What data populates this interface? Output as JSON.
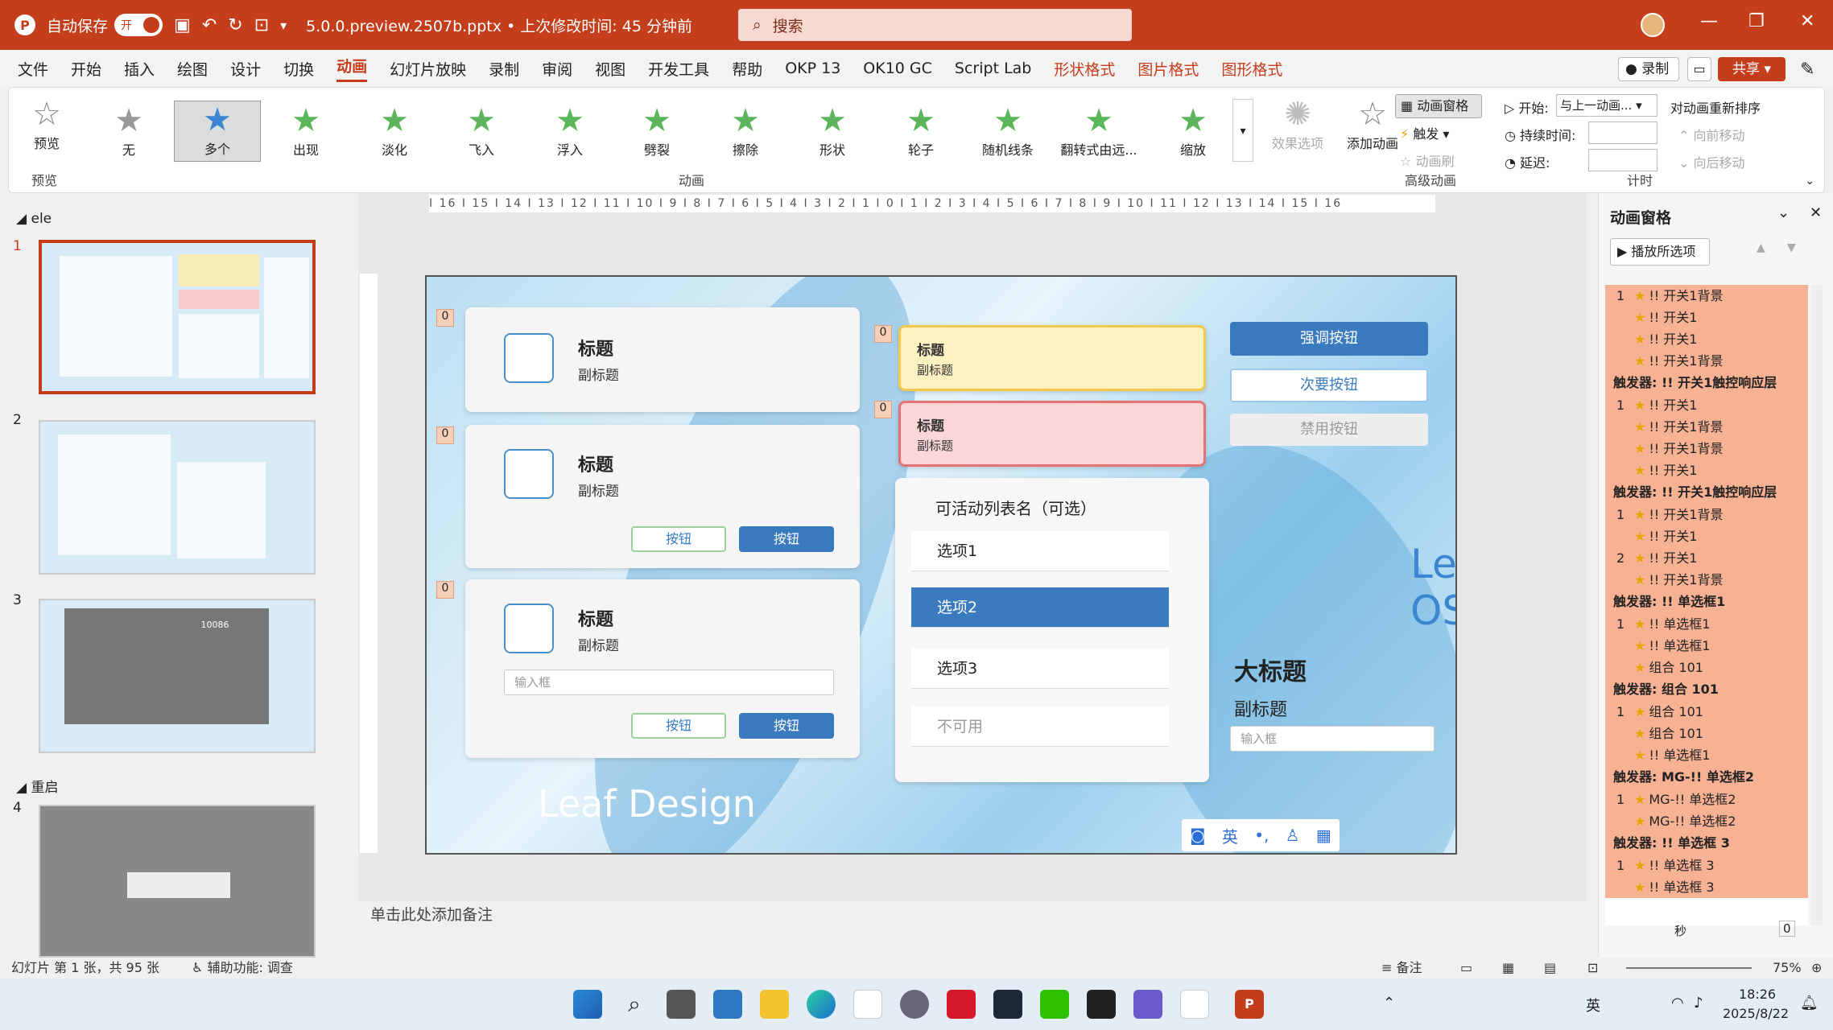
{
  "titlebar": {
    "autosave_label": "自动保存",
    "toggle": "开",
    "filename": "5.0.0.preview.2507b.pptx • 上次修改时间: 45 分钟前",
    "search_placeholder": "搜索"
  },
  "menu": [
    "文件",
    "开始",
    "插入",
    "绘图",
    "设计",
    "切换",
    "动画",
    "幻灯片放映",
    "录制",
    "审阅",
    "视图",
    "开发工具",
    "帮助",
    "OKP 13",
    "OK10 GC",
    "Script Lab",
    "形状格式",
    "图片格式",
    "图形格式"
  ],
  "menu_right": {
    "record": "录制",
    "share": "共享"
  },
  "ribbon": {
    "preview": "预览",
    "effects": [
      "无",
      "多个",
      "出现",
      "淡化",
      "飞入",
      "浮入",
      "劈裂",
      "擦除",
      "形状",
      "轮子",
      "随机线条",
      "翻转式由远...",
      "缩放"
    ],
    "effect_options": "效果选项",
    "add_animation": "添加动画",
    "anim_pane": "动画窗格",
    "trigger": "触发",
    "anim_brush": "动画刷",
    "start_label": "开始:",
    "start_value": "与上一动画...",
    "duration_label": "持续时间:",
    "delay_label": "延迟:",
    "reorder": "对动画重新排序",
    "move_earlier": "向前移动",
    "move_later": "向后移动",
    "group_anim": "动画",
    "group_adv": "高级动画",
    "group_timing": "计时",
    "group_preview": "预览"
  },
  "slides_pane": {
    "section1": "ele",
    "section2": "重启",
    "numbers": [
      "1",
      "2",
      "3",
      "4"
    ],
    "thumb3_text": "10086"
  },
  "slide": {
    "card_title": "标题",
    "card_sub": "副标题",
    "btn": "按钮",
    "input": "输入框",
    "list_title": "可活动列表名（可选）",
    "options": [
      "选项1",
      "选项2",
      "选项3",
      "不可用"
    ],
    "strong_btn": "强调按钮",
    "secondary_btn": "次要按钮",
    "disabled_btn": "禁用按钮",
    "big_title": "大标题",
    "big_sub": "副标题",
    "leaf_os": "Leaf OS",
    "leaf_design": "Leaf Design",
    "ime": "英",
    "tag0": "0"
  },
  "notes": "单击此处添加备注",
  "anim_pane": {
    "title": "动画窗格",
    "play": "播放所选项",
    "rows": [
      {
        "t": "row",
        "n": "1",
        "text": "!! 开关1背景"
      },
      {
        "t": "row",
        "n": "",
        "text": "!! 开关1"
      },
      {
        "t": "row",
        "n": "",
        "text": "!! 开关1"
      },
      {
        "t": "row",
        "n": "",
        "text": "!! 开关1背景"
      },
      {
        "t": "head",
        "text": "触发器: !! 开关1触控响应层"
      },
      {
        "t": "row",
        "n": "1",
        "text": "!! 开关1"
      },
      {
        "t": "row",
        "n": "",
        "text": "!! 开关1背景"
      },
      {
        "t": "row",
        "n": "",
        "text": "!! 开关1背景"
      },
      {
        "t": "row",
        "n": "",
        "text": "!! 开关1"
      },
      {
        "t": "head",
        "text": "触发器: !! 开关1触控响应层"
      },
      {
        "t": "row",
        "n": "1",
        "text": "!! 开关1背景"
      },
      {
        "t": "row",
        "n": "",
        "text": "!! 开关1"
      },
      {
        "t": "row",
        "n": "2",
        "text": "!! 开关1"
      },
      {
        "t": "row",
        "n": "",
        "text": "!! 开关1背景"
      },
      {
        "t": "head",
        "text": "触发器: !! 单选框1"
      },
      {
        "t": "row",
        "n": "1",
        "text": "!! 单选框1"
      },
      {
        "t": "row",
        "n": "",
        "text": "!! 单选框1"
      },
      {
        "t": "row",
        "n": "",
        "text": "组合 101"
      },
      {
        "t": "head",
        "text": "触发器: 组合 101"
      },
      {
        "t": "row",
        "n": "1",
        "text": "组合 101"
      },
      {
        "t": "row",
        "n": "",
        "text": "组合 101"
      },
      {
        "t": "row",
        "n": "",
        "text": "!! 单选框1"
      },
      {
        "t": "head",
        "text": "触发器: MG-!! 单选框2"
      },
      {
        "t": "row",
        "n": "1",
        "text": "MG-!! 单选框2"
      },
      {
        "t": "row",
        "n": "",
        "text": "MG-!! 单选框2"
      },
      {
        "t": "head",
        "text": "触发器: !! 单选框 3"
      },
      {
        "t": "row",
        "n": "1",
        "text": "!! 单选框 3"
      },
      {
        "t": "row",
        "n": "",
        "text": "!! 单选框 3"
      }
    ],
    "seconds": "秒",
    "page": "0"
  },
  "status": {
    "slide_info": "幻灯片 第 1 张，共 95 张",
    "accessibility": "辅助功能: 调查",
    "notes_btn": "备注",
    "zoom": "75%"
  },
  "taskbar": {
    "time": "18:26",
    "date": "2025/8/22",
    "lang": "英"
  }
}
